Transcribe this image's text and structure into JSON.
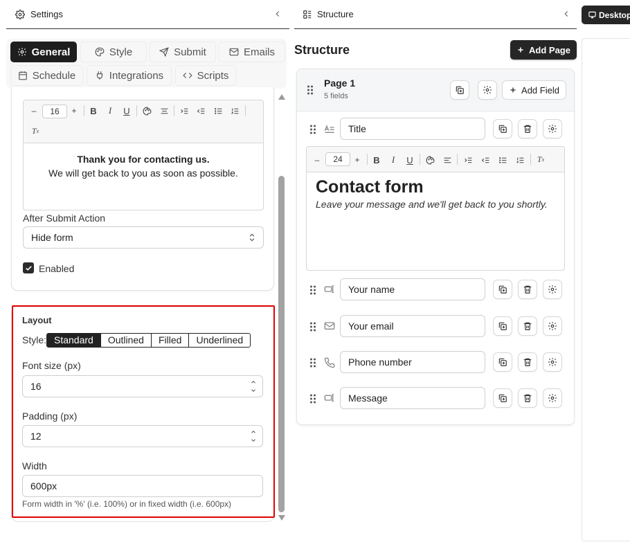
{
  "settings_panel": {
    "title": "Settings",
    "tabs": [
      {
        "label": "General",
        "icon": "gear-icon",
        "active": true
      },
      {
        "label": "Style",
        "icon": "palette-icon",
        "active": false
      },
      {
        "label": "Submit",
        "icon": "send-icon",
        "active": false
      },
      {
        "label": "Emails",
        "icon": "mail-icon",
        "active": false
      },
      {
        "label": "Schedule",
        "icon": "calendar-icon",
        "active": false
      },
      {
        "label": "Integrations",
        "icon": "plug-icon",
        "active": false
      },
      {
        "label": "Scripts",
        "icon": "code-icon",
        "active": false
      }
    ],
    "success_editor": {
      "font_size": "16",
      "heading": "Thank you for contacting us.",
      "text": "We will get back to you as soon as possible."
    },
    "after_submit": {
      "label": "After Submit Action",
      "value": "Hide form"
    },
    "enabled": {
      "label": "Enabled",
      "checked": true
    },
    "layout": {
      "title": "Layout",
      "style_label": "Style:",
      "styles": [
        "Standard",
        "Outlined",
        "Filled",
        "Underlined"
      ],
      "selected_style": "Standard",
      "font_size_label": "Font size (px)",
      "font_size_value": "16",
      "padding_label": "Padding (px)",
      "padding_value": "12",
      "width_label": "Width",
      "width_value": "600px",
      "width_help": "Form width in '%' (i.e. 100%) or in fixed width (i.e. 600px)"
    }
  },
  "structure_panel": {
    "header_title": "Structure",
    "title": "Structure",
    "add_page_label": "Add Page",
    "page": {
      "name": "Page 1",
      "count": "5 fields",
      "add_field_label": "Add Field"
    },
    "title_field": "Title",
    "title_editor": {
      "font_size": "24",
      "heading": "Contact form",
      "text": "Leave your message and we'll get back to you shortly."
    },
    "fields": [
      {
        "label": "Your name",
        "type_icon": "text-input-icon"
      },
      {
        "label": "Your email",
        "type_icon": "mail-icon"
      },
      {
        "label": "Phone number",
        "type_icon": "phone-icon"
      },
      {
        "label": "Message",
        "type_icon": "text-input-icon"
      }
    ]
  },
  "preview": {
    "device_label": "Desktop"
  }
}
